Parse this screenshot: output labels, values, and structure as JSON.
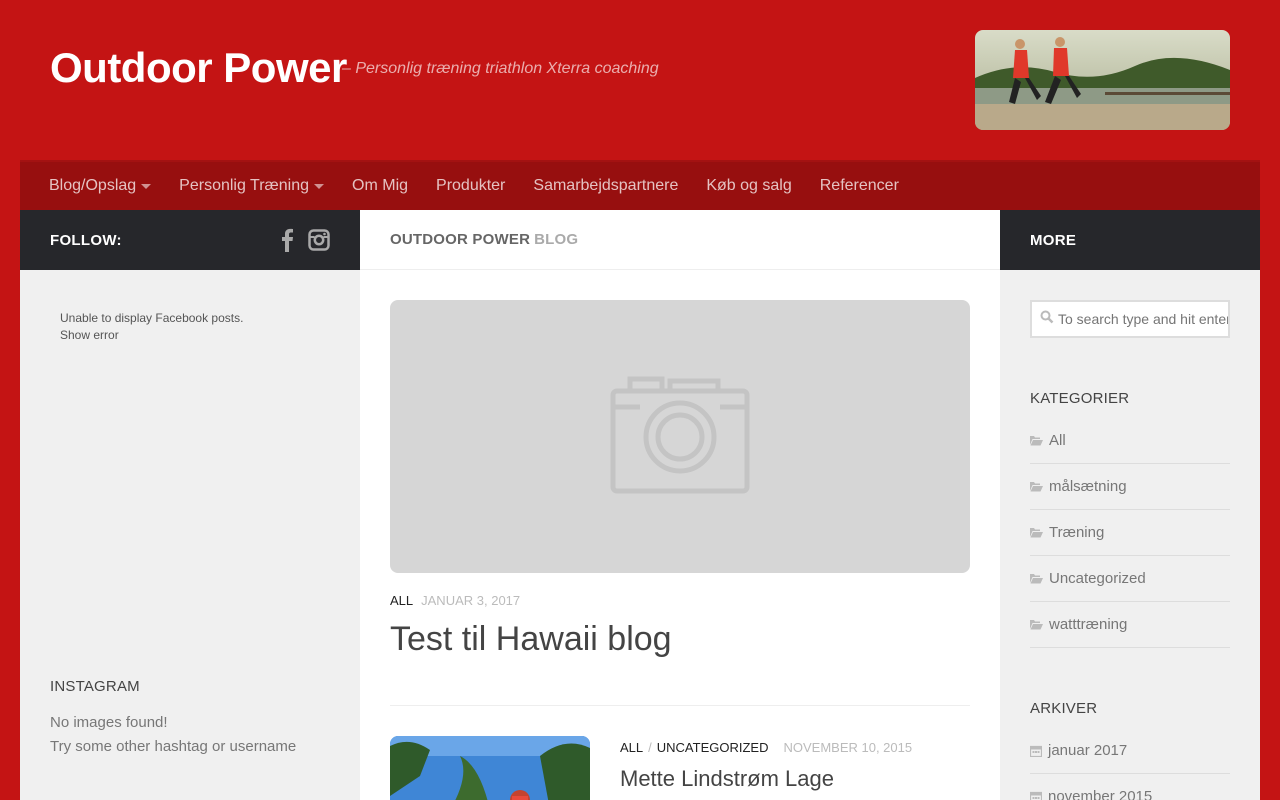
{
  "header": {
    "site_title": "Outdoor Power",
    "tagline": "– Personlig træning triathlon Xterra coaching"
  },
  "nav": {
    "items": [
      {
        "label": "Blog/Opslag"
      },
      {
        "label": "Personlig Træning"
      },
      {
        "label": "Om Mig"
      },
      {
        "label": "Produkter"
      },
      {
        "label": "Samarbejdspartnere"
      },
      {
        "label": "Køb og salg"
      },
      {
        "label": "Referencer"
      }
    ]
  },
  "left": {
    "follow_label": "FOLLOW:",
    "fb_error": "Unable to display Facebook posts.",
    "fb_show_error": "Show error",
    "instagram_title": "INSTAGRAM",
    "instagram_msg1": "No images found!",
    "instagram_msg2": "Try some other hashtag or username"
  },
  "main": {
    "head_a": "OUTDOOR POWER",
    "head_b": "BLOG",
    "post1": {
      "category": "ALL",
      "date": "JANUAR 3, 2017",
      "title": "Test til Hawaii blog"
    },
    "post2": {
      "category1": "ALL",
      "separator": "/",
      "category2": "UNCATEGORIZED",
      "date": "NOVEMBER 10, 2015",
      "title": "Mette Lindstrøm Lage"
    }
  },
  "right": {
    "more_label": "MORE",
    "search_placeholder": "To search type and hit enter",
    "categories_title": "KATEGORIER",
    "categories": [
      "All",
      "målsætning",
      "Træning",
      "Uncategorized",
      "watttræning"
    ],
    "archives_title": "ARKIVER",
    "archives": [
      "januar 2017",
      "november 2015"
    ]
  },
  "colors": {
    "brand_red": "#c41414",
    "nav_red": "#970f0f",
    "dark_head": "#26272b"
  }
}
